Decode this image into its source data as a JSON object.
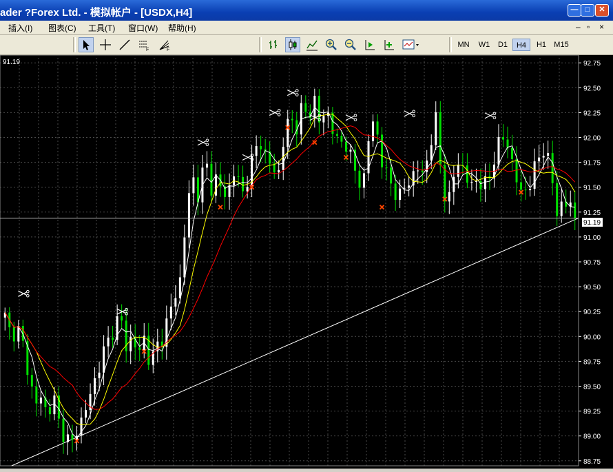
{
  "window": {
    "title": "ader ?Forex Ltd. - 模拟帐户 - [USDX,H4]",
    "minimize_glyph": "—",
    "maximize_glyph": "□",
    "close_glyph": "✕"
  },
  "menu": {
    "items": [
      {
        "label": "插入(I)"
      },
      {
        "label": "图表(C)"
      },
      {
        "label": "工具(T)"
      },
      {
        "label": "窗口(W)"
      },
      {
        "label": "帮助(H)"
      }
    ],
    "mdi_controls": [
      "–",
      "▫",
      "×"
    ]
  },
  "toolbar": {
    "icons": [
      "cursor-icon",
      "crosshair-icon",
      "trendline-icon",
      "fibonacci-icon",
      "fibo-fan-icon",
      "bar-chart-icon",
      "candlestick-icon",
      "line-chart-icon",
      "zoom-in-icon",
      "zoom-out-icon",
      "chart-shift-icon",
      "autoscroll-icon",
      "templates-icon"
    ],
    "timeframes": [
      {
        "label": "MN",
        "active": false
      },
      {
        "label": "W1",
        "active": false
      },
      {
        "label": "D1",
        "active": false
      },
      {
        "label": "H4",
        "active": true
      },
      {
        "label": "H1",
        "active": false
      },
      {
        "label": "M15",
        "active": false
      }
    ]
  },
  "chart_data": {
    "type": "candlestick",
    "symbol": "USDX",
    "timeframe": "H4",
    "top_left_price": "91.19",
    "current_price_label": "91.19",
    "current_price": 91.19,
    "ylim": [
      88.7,
      92.8
    ],
    "y_ticks": [
      "92.75",
      "92.50",
      "92.25",
      "92.00",
      "91.75",
      "91.50",
      "91.25",
      "91.00",
      "90.75",
      "90.50",
      "90.25",
      "90.00",
      "89.75",
      "89.50",
      "89.25",
      "89.00",
      "88.75"
    ],
    "colors": {
      "background": "#000000",
      "grid": "#4a4a4a",
      "bull": "#ffffff",
      "bear": "#00e000",
      "ma_fast": "#ffffff",
      "ma_mid": "#ffff00",
      "ma_slow": "#ff0000",
      "trendline": "#ffffff",
      "marker_orange": "#ff4500"
    },
    "trendline": {
      "from_x": 0.02,
      "from_price": 88.7,
      "to_x": 1.0,
      "to_price": 91.19
    },
    "closes": [
      90.2,
      90.0,
      90.1,
      89.9,
      89.6,
      89.3,
      89.4,
      89.2,
      89.4,
      89.1,
      89.0,
      88.9,
      89.1,
      89.2,
      89.4,
      89.6,
      89.8,
      89.95,
      90.1,
      90.2,
      89.9,
      90.0,
      89.8,
      90.0,
      89.7,
      89.9,
      90.0,
      90.2,
      90.4,
      90.6,
      91.3,
      91.6,
      91.4,
      91.8,
      91.5,
      91.6,
      91.4,
      91.5,
      91.7,
      91.4,
      91.6,
      91.8,
      92.0,
      91.8,
      91.7,
      91.6,
      92.0,
      92.2,
      92.1,
      92.3,
      92.2,
      92.4,
      92.1,
      92.3,
      92.1,
      91.9,
      92.0,
      91.8,
      91.6,
      91.5,
      92.0,
      92.2,
      91.8,
      91.6,
      91.5,
      91.4,
      91.5,
      91.6,
      91.7,
      91.6,
      91.9,
      92.2,
      91.6,
      91.3,
      91.6,
      91.8,
      91.6,
      91.5,
      91.6,
      91.5,
      91.6,
      91.9,
      92.0,
      91.9,
      91.7,
      91.4,
      91.5,
      91.6,
      91.8,
      91.9,
      91.7,
      91.2,
      91.4,
      91.3,
      91.19
    ],
    "markers": [
      {
        "i": 4,
        "price": 90.43,
        "type": "scissors"
      },
      {
        "i": 26,
        "price": 90.25,
        "type": "scissors"
      },
      {
        "i": 44,
        "price": 91.95,
        "type": "scissors"
      },
      {
        "i": 54,
        "price": 91.8,
        "type": "scissors"
      },
      {
        "i": 60,
        "price": 92.25,
        "type": "scissors"
      },
      {
        "i": 64,
        "price": 92.45,
        "type": "scissors"
      },
      {
        "i": 69,
        "price": 92.2,
        "type": "scissors"
      },
      {
        "i": 77,
        "price": 92.2,
        "type": "scissors"
      },
      {
        "i": 90,
        "price": 92.24,
        "type": "scissors"
      },
      {
        "i": 108,
        "price": 92.22,
        "type": "scissors"
      },
      {
        "i": 16,
        "price": 88.95,
        "type": "cross"
      },
      {
        "i": 31,
        "price": 89.85,
        "type": "cross"
      },
      {
        "i": 48,
        "price": 91.3,
        "type": "cross"
      },
      {
        "i": 55,
        "price": 91.5,
        "type": "cross"
      },
      {
        "i": 63,
        "price": 92.1,
        "type": "cross"
      },
      {
        "i": 69,
        "price": 91.95,
        "type": "cross"
      },
      {
        "i": 76,
        "price": 91.8,
        "type": "cross"
      },
      {
        "i": 84,
        "price": 91.3,
        "type": "cross"
      },
      {
        "i": 98,
        "price": 91.38,
        "type": "cross"
      },
      {
        "i": 115,
        "price": 91.45,
        "type": "cross"
      }
    ]
  }
}
